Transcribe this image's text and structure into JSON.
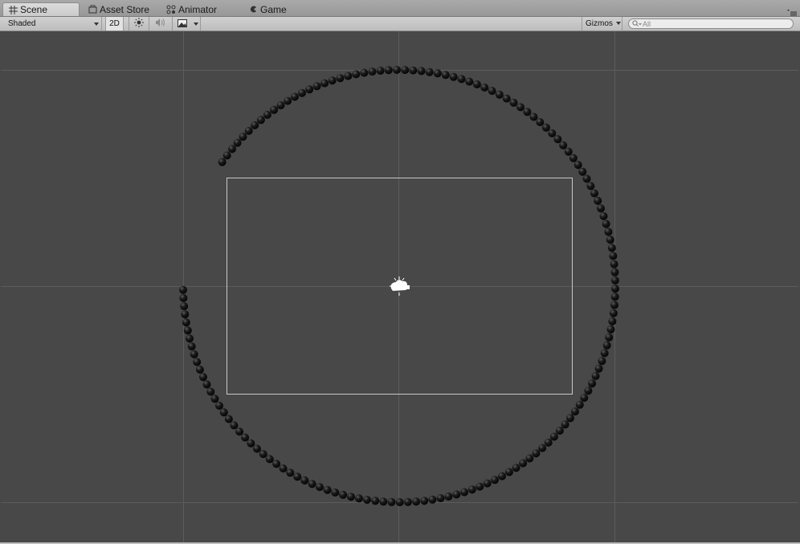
{
  "tabs": [
    {
      "label": "Scene",
      "icon": "grid-icon",
      "active": true
    },
    {
      "label": "Asset Store",
      "icon": "store-icon",
      "active": false
    },
    {
      "label": "Animator",
      "icon": "animator-icon",
      "active": false
    },
    {
      "label": "Game",
      "icon": "game-icon",
      "active": false
    }
  ],
  "toolbar": {
    "shading_mode": "Shaded",
    "mode_2d": "2D",
    "lighting_icon": "sun-icon",
    "audio_icon": "speaker-icon",
    "effects_icon": "image-icon",
    "gizmos_label": "Gizmos",
    "search_placeholder": "All"
  },
  "scene": {
    "camera_icon": "camera-gizmo-icon",
    "colors": {
      "background": "#484848",
      "grid": "#5c5c5c",
      "frame": "#c8c8c8",
      "ball": "#0d0d0d"
    }
  }
}
